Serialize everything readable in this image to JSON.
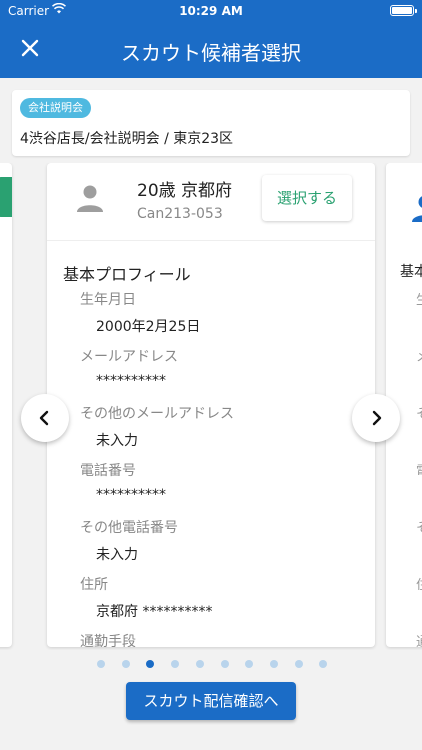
{
  "status_bar": {
    "carrier": "Carrier",
    "time": "10:29 AM"
  },
  "nav": {
    "close_icon": "close-icon",
    "title": "スカウト候補者選択"
  },
  "event": {
    "badge": "会社説明会",
    "summary": "4渋谷店長/会社説明会 / 東京23区"
  },
  "candidate": {
    "headline": "20歳 京都府",
    "id": "Can213-053",
    "select_label": "選択する",
    "section_title": "基本プロフィール",
    "fields": [
      {
        "label": "生年月日",
        "value": "2000年2月25日"
      },
      {
        "label": "メールアドレス",
        "value": "**********"
      },
      {
        "label": "その他のメールアドレス",
        "value": "未入力"
      },
      {
        "label": "電話番号",
        "value": "**********"
      },
      {
        "label": "その他電話番号",
        "value": "未入力"
      },
      {
        "label": "住所",
        "value": "京都府 **********"
      },
      {
        "label": "通勤手段",
        "value": ""
      }
    ]
  },
  "next_card": {
    "section_peek": "基本",
    "label_peeks": [
      "生",
      "メ",
      "そ",
      "電",
      "そ",
      "住",
      "通"
    ]
  },
  "pager": {
    "count": 10,
    "active_index": 2
  },
  "colors": {
    "primary": "#1b6cc6",
    "accent_green": "#2aa171",
    "badge": "#4fb9e0"
  },
  "confirm_label": "スカウト配信確認へ"
}
